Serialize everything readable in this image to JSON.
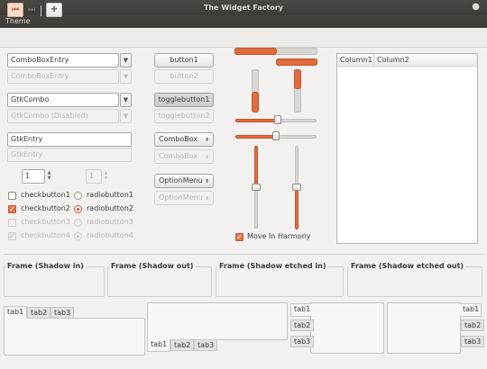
{
  "window": {
    "title": "The Widget Factory"
  },
  "menubar": {
    "items": [
      "Theme"
    ]
  },
  "entries": {
    "combo_entry": "ComboBoxEntry",
    "combo_entry_disabled": "ComboBoxEntry",
    "gtk_combo": "GtkCombo",
    "gtk_combo_disabled": "GtkCombo (Disabled)",
    "gtk_entry": "GtkEntry",
    "gtk_entry_disabled": "GtkEntry",
    "spin_value": "1",
    "spin_disabled_value": "1"
  },
  "checks": {
    "checkbutton1": "checkbutton1",
    "checkbutton2": "checkbutton2",
    "checkbutton3": "checkbutton3",
    "checkbutton4": "checkbutton4"
  },
  "radios": {
    "radiobutton1": "radiobutton1",
    "radiobutton2": "radiobutton2",
    "radiobutton3": "radiobutton3",
    "radiobutton4": "radiobutton4"
  },
  "buttons": {
    "button1": "button1",
    "button2": "button2",
    "togglebutton1": "togglebutton1",
    "togglebutton2": "togglebutton2",
    "combobox": "ComboBox",
    "combobox_disabled": "ComboBox",
    "optionmenu": "OptionMenu",
    "optionmenu_disabled": "OptionMenu"
  },
  "harmony": {
    "label": "Move In Harmony",
    "checked": true
  },
  "treeview": {
    "columns": [
      "Column1",
      "Column2"
    ]
  },
  "frames": [
    "Frame (Shadow in)",
    "Frame (Shadow out)",
    "Frame (Shadow etched in)",
    "Frame (Shadow etched out)"
  ],
  "notebooks": {
    "tabs": [
      "tab1",
      "tab2",
      "tab3"
    ]
  },
  "colors": {
    "accent": "#dd4814",
    "titlebar": "#3c3b37",
    "background": "#f2f1f0"
  }
}
